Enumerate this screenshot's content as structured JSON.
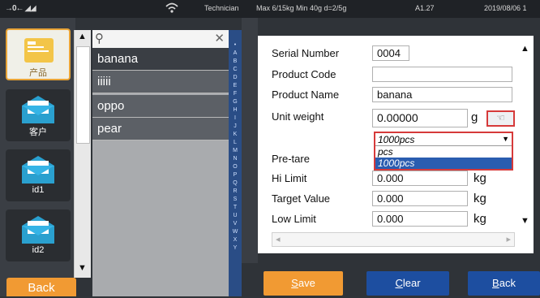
{
  "status_bar": {
    "signal": "→0← ◢◢",
    "wifi_icon": "wifi-icon",
    "role": "Technician",
    "capacity": "Max 6/15kg  Min 40g  d=2/5g",
    "version": "A1.27",
    "date": "2019/08/06 1"
  },
  "nav": [
    {
      "label": "产品",
      "icon": "product-icon",
      "active": true
    },
    {
      "label": "客户",
      "icon": "customer-icon",
      "active": false
    },
    {
      "label": "id1",
      "icon": "id1-icon",
      "active": false
    },
    {
      "label": "id2",
      "icon": "id2-icon",
      "active": false
    }
  ],
  "back_left": "Back",
  "search": {
    "placeholder": ""
  },
  "products": [
    "banana",
    "iiiii",
    "oppo",
    "pear"
  ],
  "alphabet": "•ABCDEFGHIJKLMNOPQRSTUVWXY",
  "form": {
    "serial_label": "Serial Number",
    "serial_value": "0004",
    "code_label": "Product Code",
    "code_value": "",
    "name_label": "Product Name",
    "name_value": "banana",
    "unit_weight_label": "Unit weight",
    "unit_weight_value": "0.00000",
    "unit_weight_unit": "g",
    "pcs_selected": "1000pcs",
    "pcs_options": [
      "pcs",
      "1000pcs"
    ],
    "pretare_label": "Pre-tare",
    "hi_label": "Hi Limit",
    "hi_value": "0.000",
    "hi_unit": "kg",
    "target_label": "Target Value",
    "target_value": "0.000",
    "target_unit": "kg",
    "low_label": "Low Limit",
    "low_value": "0.000",
    "low_unit": "kg"
  },
  "buttons": {
    "save_first": "S",
    "save_rest": "ave",
    "clear_first": "C",
    "clear_rest": "lear",
    "back_first": "B",
    "back_rest": "ack"
  }
}
